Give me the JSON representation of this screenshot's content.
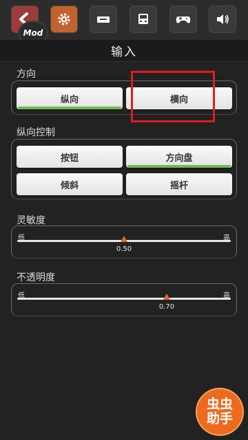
{
  "toolbar": {
    "mod_badge": "Mod",
    "icons": [
      "back-icon",
      "gear-icon",
      "ticket-icon",
      "truck-icon",
      "gamepad-icon",
      "speaker-icon"
    ]
  },
  "title": "输入",
  "orientation": {
    "label": "方向",
    "options": [
      "纵向",
      "横向"
    ],
    "selected": "纵向"
  },
  "steering": {
    "label": "纵向控制",
    "options": [
      "按钮",
      "方向盘",
      "倾斜",
      "摇杆"
    ],
    "selected": "方向盘"
  },
  "sensitivity": {
    "label": "灵敏度",
    "min_label": "低",
    "max_label": "高",
    "value": 0.5,
    "value_text": "0.50"
  },
  "opacity": {
    "label": "不透明度",
    "min_label": "低",
    "max_label": "高",
    "value": 0.7,
    "value_text": "0.70"
  },
  "corner_badge": {
    "line1": "虫虫",
    "line2": "助手"
  },
  "colors": {
    "accent_green": "#6cbb4c",
    "thumb_orange": "#e06a2a",
    "highlight_red": "#e11c1c",
    "badge_orange": "#ee6a1f"
  }
}
